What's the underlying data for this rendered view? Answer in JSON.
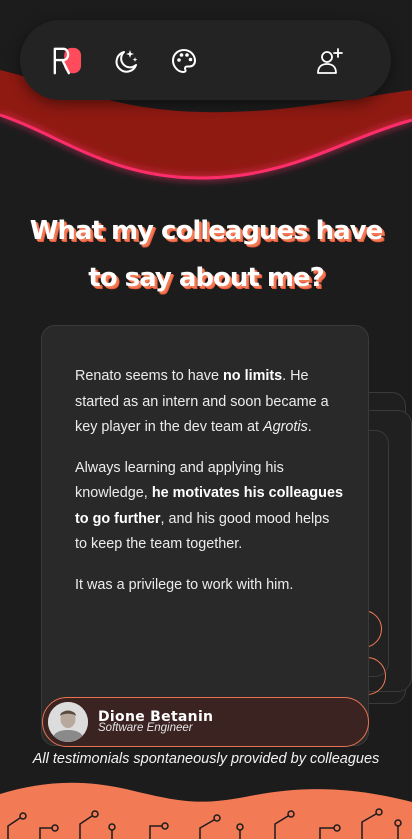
{
  "colors": {
    "background": "#1c1c1c",
    "accent": "#f27a55",
    "wave_red": "#8f1a12",
    "wave_pink": "#ff2d6b"
  },
  "navbar": {
    "logo_text": "RB",
    "items": [
      {
        "icon": "moon-stars-icon"
      },
      {
        "icon": "palette-icon"
      },
      {
        "icon": "add-user-icon"
      }
    ]
  },
  "heading": {
    "line1": "What my colleagues have",
    "line2": "to say about me?"
  },
  "testimonial": {
    "p1_pre": "Renato seems to have ",
    "p1_bold": "no limits",
    "p1_mid": ". He started as an intern and soon became a key player in the dev team at ",
    "p1_italic": "Agrotis",
    "p1_end": ".",
    "p2_pre": "Always learning and applying his knowledge, ",
    "p2_bold": "he motivates his colleagues to go further",
    "p2_end": ", and his good mood helps to keep the team together.",
    "p3": "It was a privilege to work with him."
  },
  "author": {
    "name": "Dione Betanin",
    "role": "Software Engineer"
  },
  "footnote": "All testimonials spontaneously provided by colleagues"
}
